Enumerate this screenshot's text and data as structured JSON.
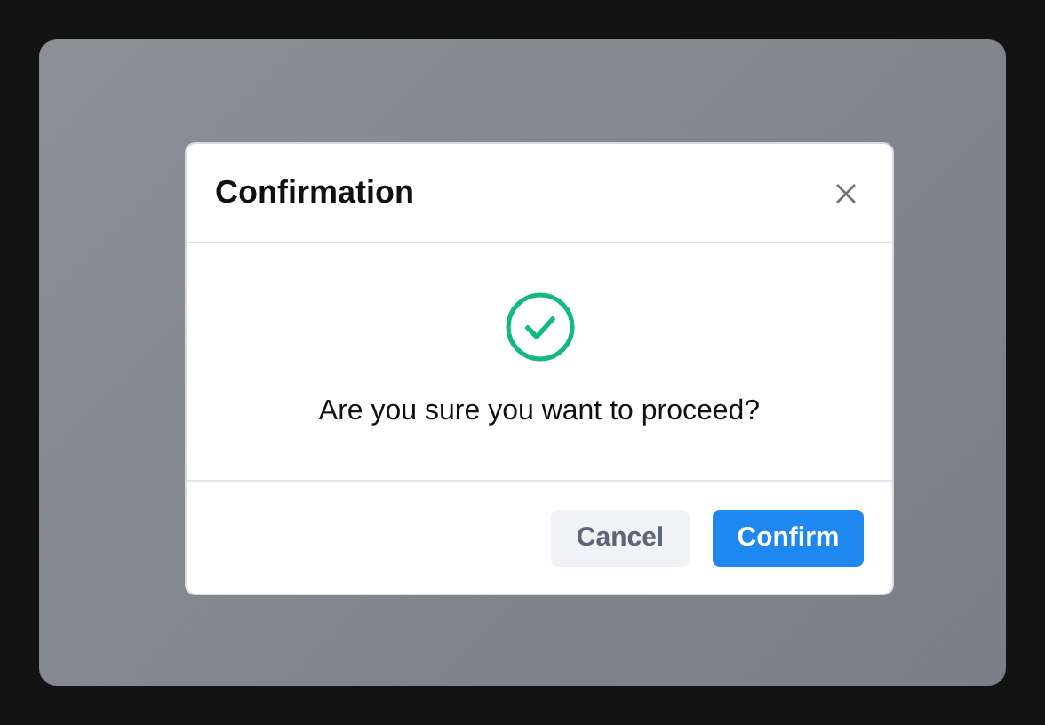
{
  "dialog": {
    "title": "Confirmation",
    "message": "Are you sure you want to proceed?",
    "buttons": [
      {
        "label": "Cancel",
        "kind": "secondary"
      },
      {
        "label": "Confirm",
        "kind": "primary"
      }
    ]
  }
}
